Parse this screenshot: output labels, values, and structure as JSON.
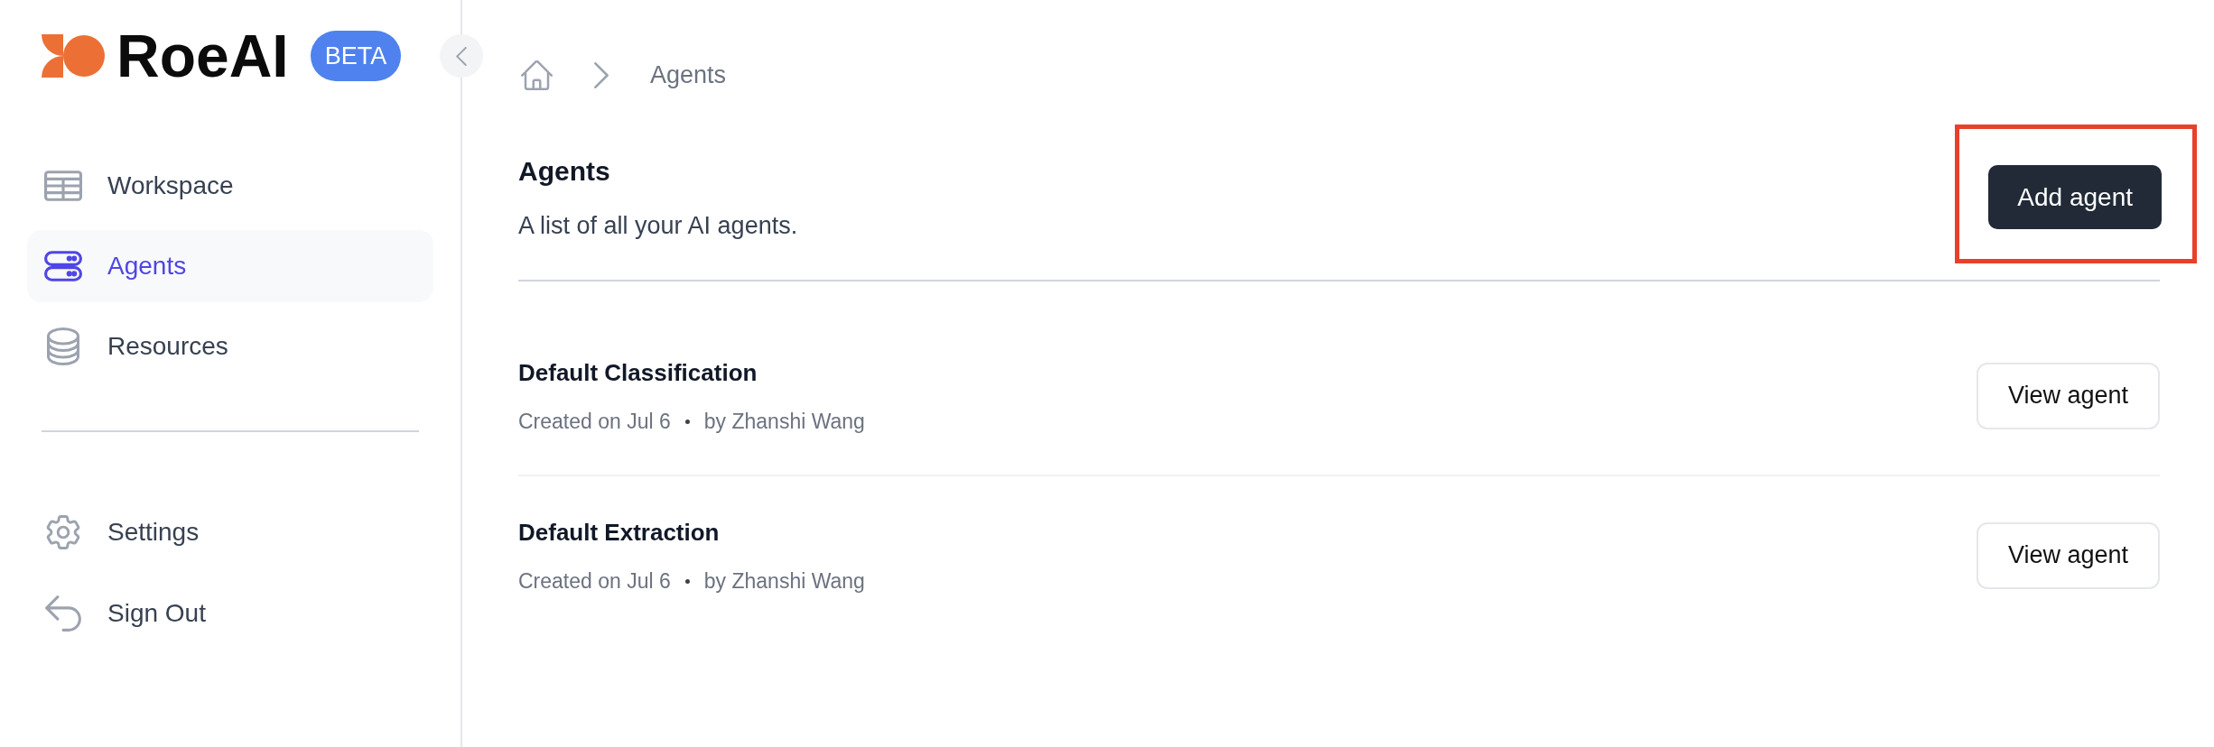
{
  "sidebar": {
    "logo": {
      "wordmark": "RoeAI",
      "badge": "BETA"
    },
    "nav_items": [
      {
        "label": "Workspace",
        "selected": false
      },
      {
        "label": "Agents",
        "selected": true
      },
      {
        "label": "Resources",
        "selected": false
      }
    ],
    "footer_items": [
      {
        "label": "Settings",
        "selected": false
      },
      {
        "label": "Sign Out",
        "selected": false
      }
    ]
  },
  "breadcrumb": {
    "current": "Agents"
  },
  "header": {
    "title": "Agents",
    "subtitle": "A list of all your AI agents.",
    "add_button": {
      "label": "Add agent",
      "highlighted": true
    }
  },
  "agents": [
    {
      "name": "Default Classification",
      "created": "Created on Jul 6",
      "author": "by Zhanshi Wang",
      "action": "View agent"
    },
    {
      "name": "Default Extraction",
      "created": "Created on Jul 6",
      "author": "by Zhanshi Wang",
      "action": "View agent"
    }
  ]
}
